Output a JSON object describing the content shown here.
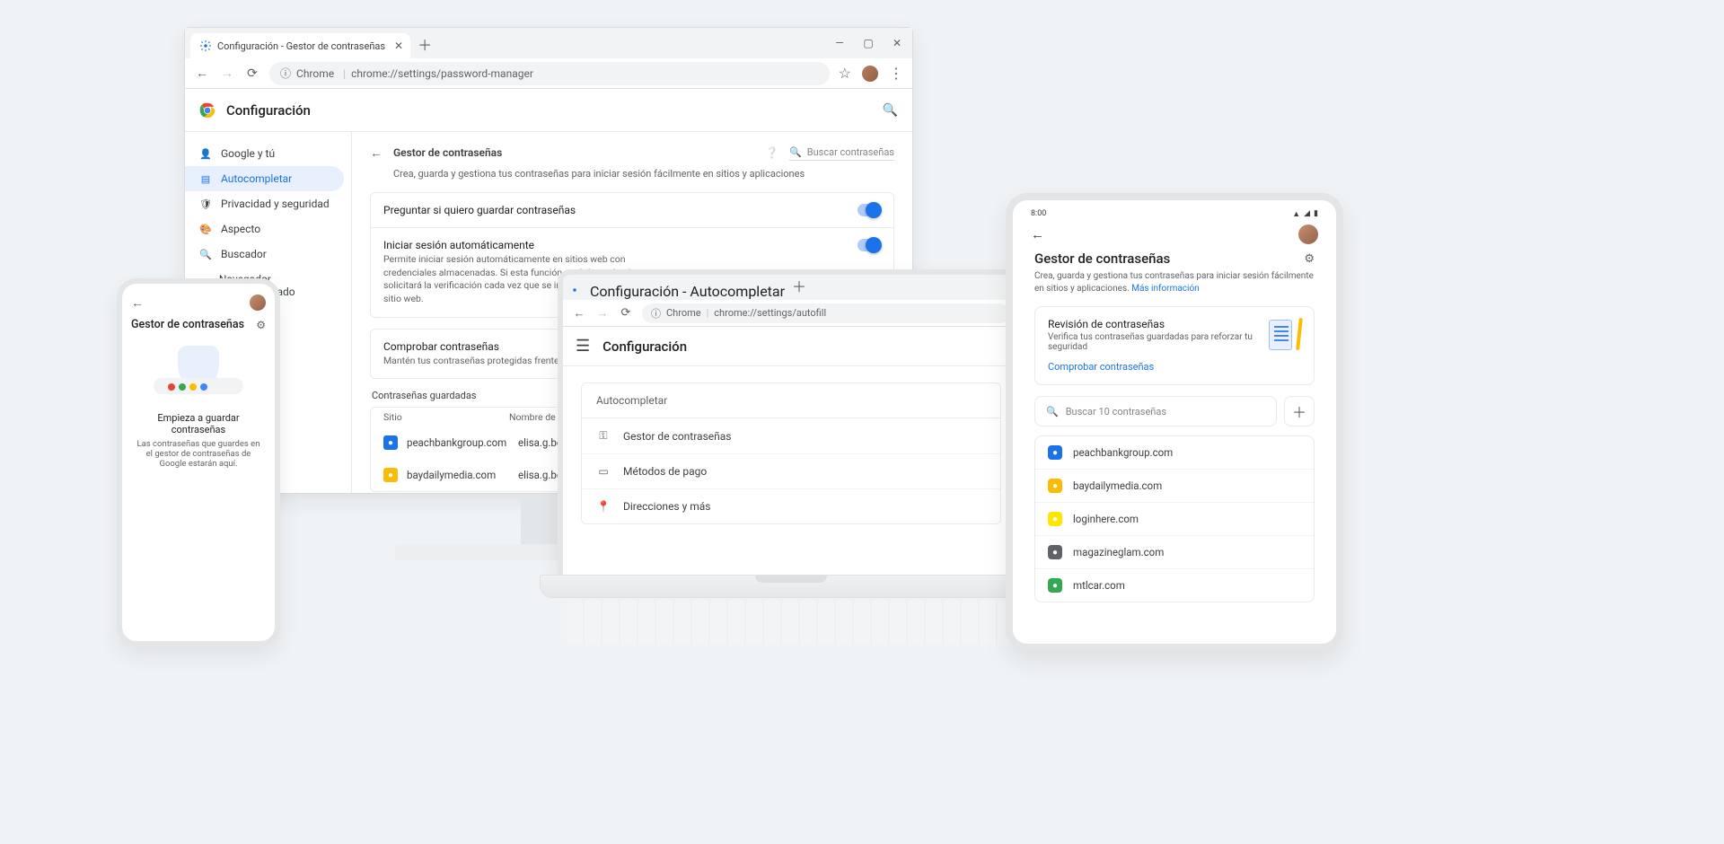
{
  "win1": {
    "tab_title": "Configuración - Gestor de contraseñas",
    "url_prefix": "Chrome",
    "url_path": "chrome://settings/password-manager",
    "app_title": "Configuración",
    "sidebar": [
      {
        "label": "Google y tú"
      },
      {
        "label": "Autocompletar"
      },
      {
        "label": "Privacidad y seguridad"
      },
      {
        "label": "Aspecto"
      },
      {
        "label": "Buscador"
      },
      {
        "label": "Navegador predeterminado"
      }
    ],
    "section_title": "Gestor de contraseñas",
    "search_placeholder": "Buscar contraseñas",
    "section_desc": "Crea, guarda y gestiona tus contraseñas para iniciar sesión fácilmente en sitios y aplicaciones",
    "row1_title": "Preguntar si quiero guardar contraseñas",
    "row2_title": "Iniciar sesión automáticamente",
    "row2_sub": "Permite iniciar sesión automáticamente en sitios web con credenciales almacenadas. Si esta función está desactivada, se solicitará la verificación cada vez que se intente iniciar sesión en un sitio web.",
    "row3_title": "Comprobar contraseñas",
    "row3_sub": "Mantén tus contraseñas protegidas frente a quiebras de seguridad",
    "saved_heading": "Contraseñas guardadas",
    "col_site": "Sitio",
    "col_user": "Nombre de usuario",
    "rows": [
      {
        "site": "peachbankgroup.com",
        "user": "elisa.g.becket@",
        "color": "#1a73e8"
      },
      {
        "site": "baydailymedia.com",
        "user": "elisa.g.becket@",
        "color": "#fbbc04"
      }
    ]
  },
  "phone": {
    "title": "Gestor de contraseñas",
    "cta": "Empieza a guardar contraseñas",
    "sub": "Las contraseñas que guardes en el gestor de contraseñas de Google estarán aquí."
  },
  "win2": {
    "tab_title": "Configuración - Autocompletar",
    "url_prefix": "Chrome",
    "url_path": "chrome://settings/autofill",
    "app_title": "Configuración",
    "group": "Autocompletar",
    "items": [
      {
        "label": "Gestor de contraseñas"
      },
      {
        "label": "Métodos de pago"
      },
      {
        "label": "Direcciones y más"
      }
    ]
  },
  "tablet": {
    "time": "8:00",
    "title": "Gestor de contraseñas",
    "desc": "Crea, guarda y gestiona tus contraseñas para iniciar sesión fácilmente en sitios y aplicaciones.",
    "more": "Más información",
    "card_title": "Revisión de contraseñas",
    "card_sub": "Verifica tus contraseñas guardadas para reforzar tu seguridad",
    "card_action": "Comprobar contraseñas",
    "search_placeholder": "Buscar 10 contraseñas",
    "rows": [
      {
        "site": "peachbankgroup.com",
        "color": "#1a73e8"
      },
      {
        "site": "baydailymedia.com",
        "color": "#fbbc04"
      },
      {
        "site": "loginhere.com",
        "color": "#ffe600"
      },
      {
        "site": "magazineglam.com",
        "color": "#5f6368"
      },
      {
        "site": "mtlcar.com",
        "color": "#34a853"
      }
    ]
  }
}
